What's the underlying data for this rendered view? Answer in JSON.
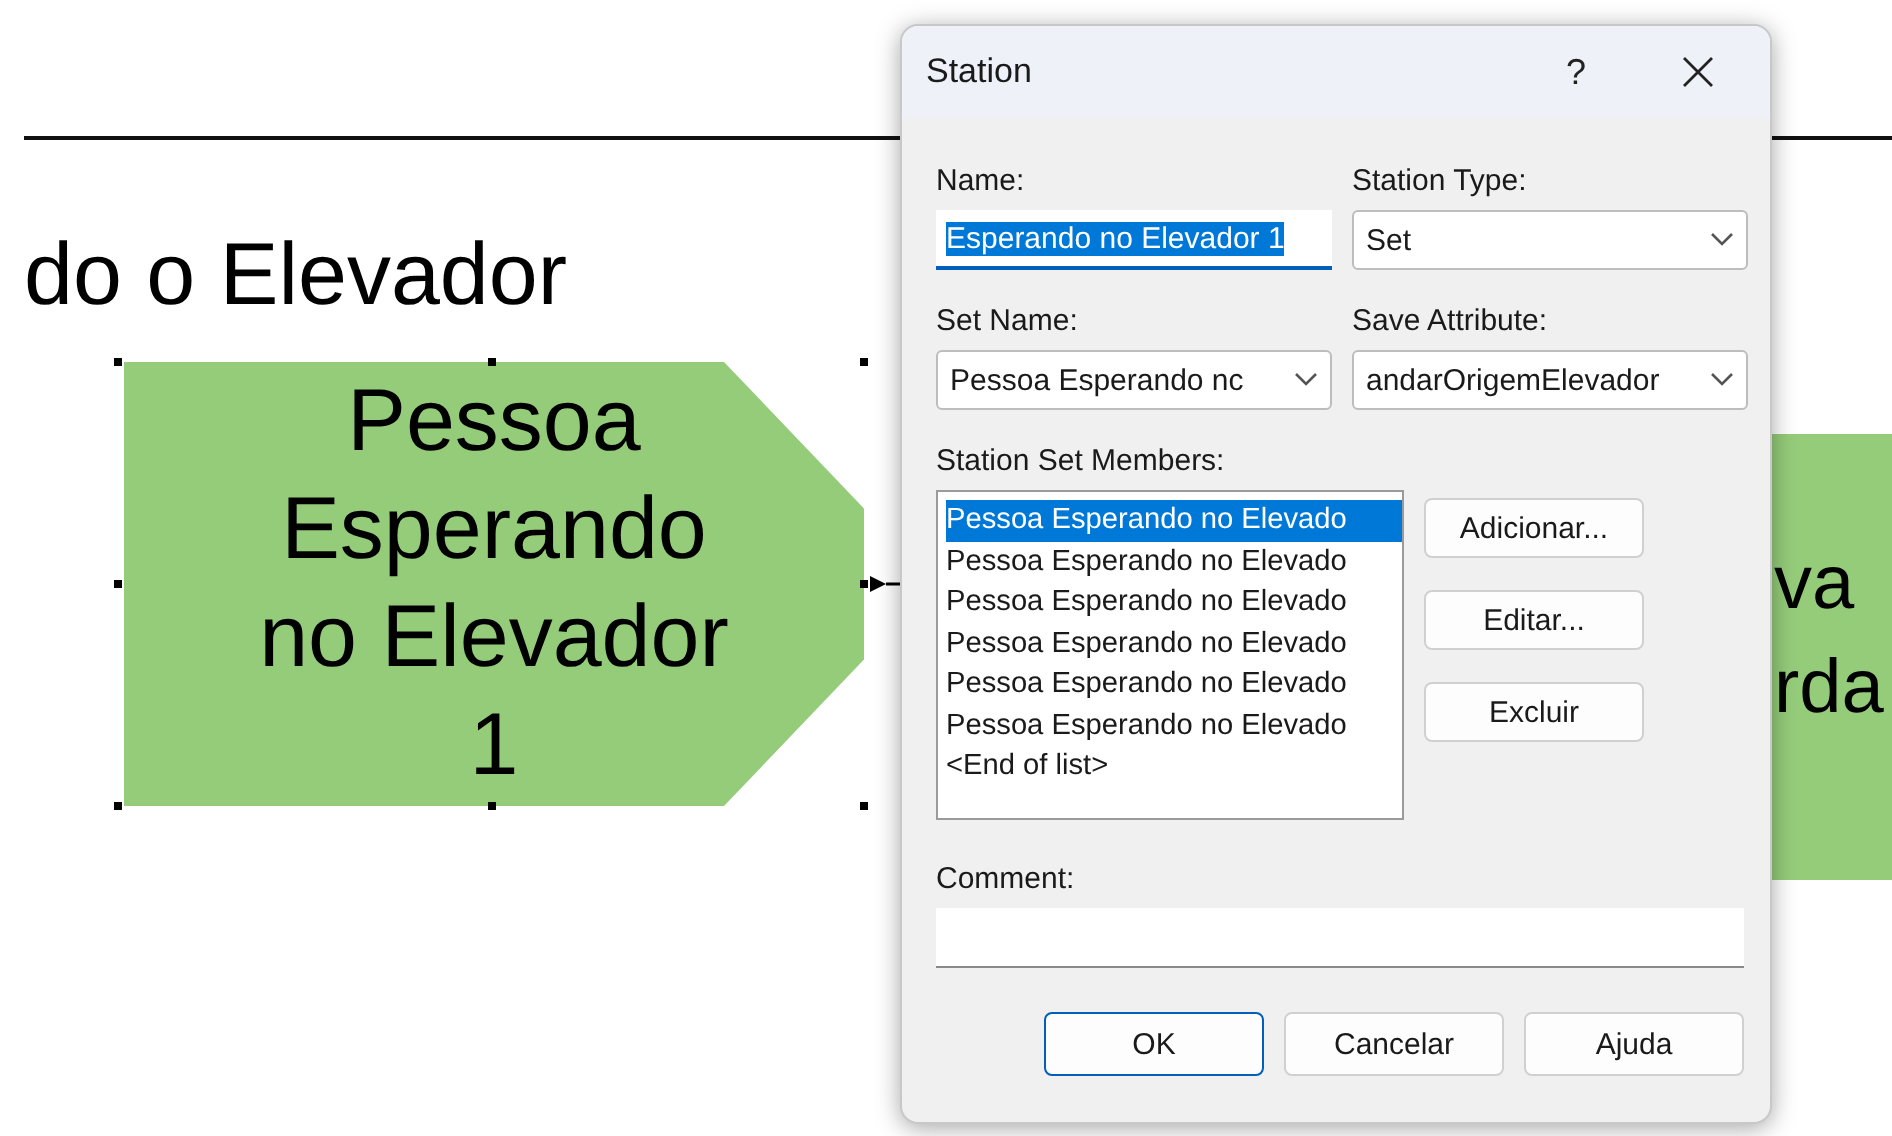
{
  "canvas": {
    "heading": "do o Elevador",
    "modules": [
      {
        "label_lines": [
          "Pessoa",
          "Esperando",
          "no Elevador",
          "1"
        ],
        "selected": true
      },
      {
        "label_lines": [
          "va",
          "rda"
        ],
        "selected": false
      }
    ]
  },
  "dialog": {
    "title": "Station",
    "help": "?",
    "fields": [
      {
        "label": "Name:",
        "value": "Esperando no Elevador 1",
        "kind": "text",
        "focused": true
      },
      {
        "label": "Station Type:",
        "value": "Set",
        "kind": "combo"
      },
      {
        "label": "Set Name:",
        "value": "Pessoa Esperando nc",
        "kind": "combo"
      },
      {
        "label": "Save Attribute:",
        "value": "andarOrigemElevador",
        "kind": "combo"
      }
    ],
    "members": {
      "label": "Station Set Members:",
      "items": [
        {
          "text": "Pessoa Esperando no Elevado",
          "selected": true
        },
        {
          "text": "Pessoa Esperando no Elevado",
          "selected": false
        },
        {
          "text": "Pessoa Esperando no Elevado",
          "selected": false
        },
        {
          "text": "Pessoa Esperando no Elevado",
          "selected": false
        },
        {
          "text": "Pessoa Esperando no Elevado",
          "selected": false
        },
        {
          "text": "Pessoa Esperando no Elevado",
          "selected": false
        },
        {
          "text": "<End of list>",
          "selected": false
        }
      ],
      "buttons": [
        "Adicionar...",
        "Editar...",
        "Excluir"
      ]
    },
    "comment": {
      "label": "Comment:"
    },
    "buttons": [
      {
        "label": "OK",
        "default": true
      },
      {
        "label": "Cancelar",
        "default": false
      },
      {
        "label": "Ajuda",
        "default": false
      }
    ]
  }
}
